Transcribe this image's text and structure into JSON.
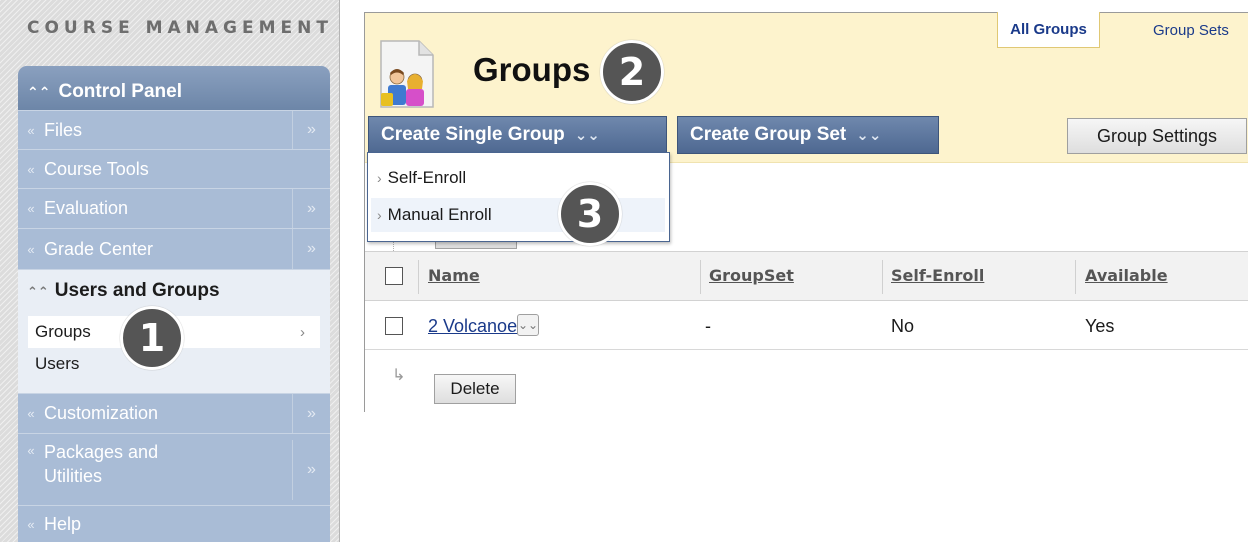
{
  "sidebar": {
    "title": "COURSE MANAGEMENT",
    "panel_title": "Control Panel",
    "items": [
      {
        "label": "Files",
        "has_arrow": true
      },
      {
        "label": "Course Tools",
        "has_arrow": false
      },
      {
        "label": "Evaluation",
        "has_arrow": true
      },
      {
        "label": "Grade Center",
        "has_arrow": true
      }
    ],
    "expanded": {
      "title": "Users and Groups",
      "sub_items": [
        "Groups",
        "Users"
      ]
    },
    "items_after": [
      {
        "label": "Customization",
        "has_arrow": true
      },
      {
        "label": "Packages and\nUtilities",
        "has_arrow": true
      },
      {
        "label": "Help",
        "has_arrow": false
      }
    ]
  },
  "header": {
    "tab_all": "All Groups",
    "tab_sets": "Group Sets",
    "title": "Groups"
  },
  "toolbar": {
    "create_single": "Create Single Group",
    "create_set": "Create Group Set",
    "settings": "Group Settings"
  },
  "dropdown": {
    "items": [
      "Self-Enroll",
      "Manual Enroll"
    ]
  },
  "table": {
    "columns": [
      "Name",
      "GroupSet",
      "Self-Enroll",
      "Available"
    ],
    "rows": [
      {
        "name": "2 Volcanoes",
        "groupset": "-",
        "self_enroll": "No",
        "available": "Yes"
      }
    ],
    "delete_label": "Delete"
  },
  "callouts": [
    "1",
    "2",
    "3"
  ],
  "icons": [
    "chevron-up-icon",
    "chevron-down-icon",
    "double-right-arrow-icon",
    "right-arrow-icon",
    "double-down-chevron-icon",
    "groups-people-icon",
    "return-arrow-icon"
  ]
}
